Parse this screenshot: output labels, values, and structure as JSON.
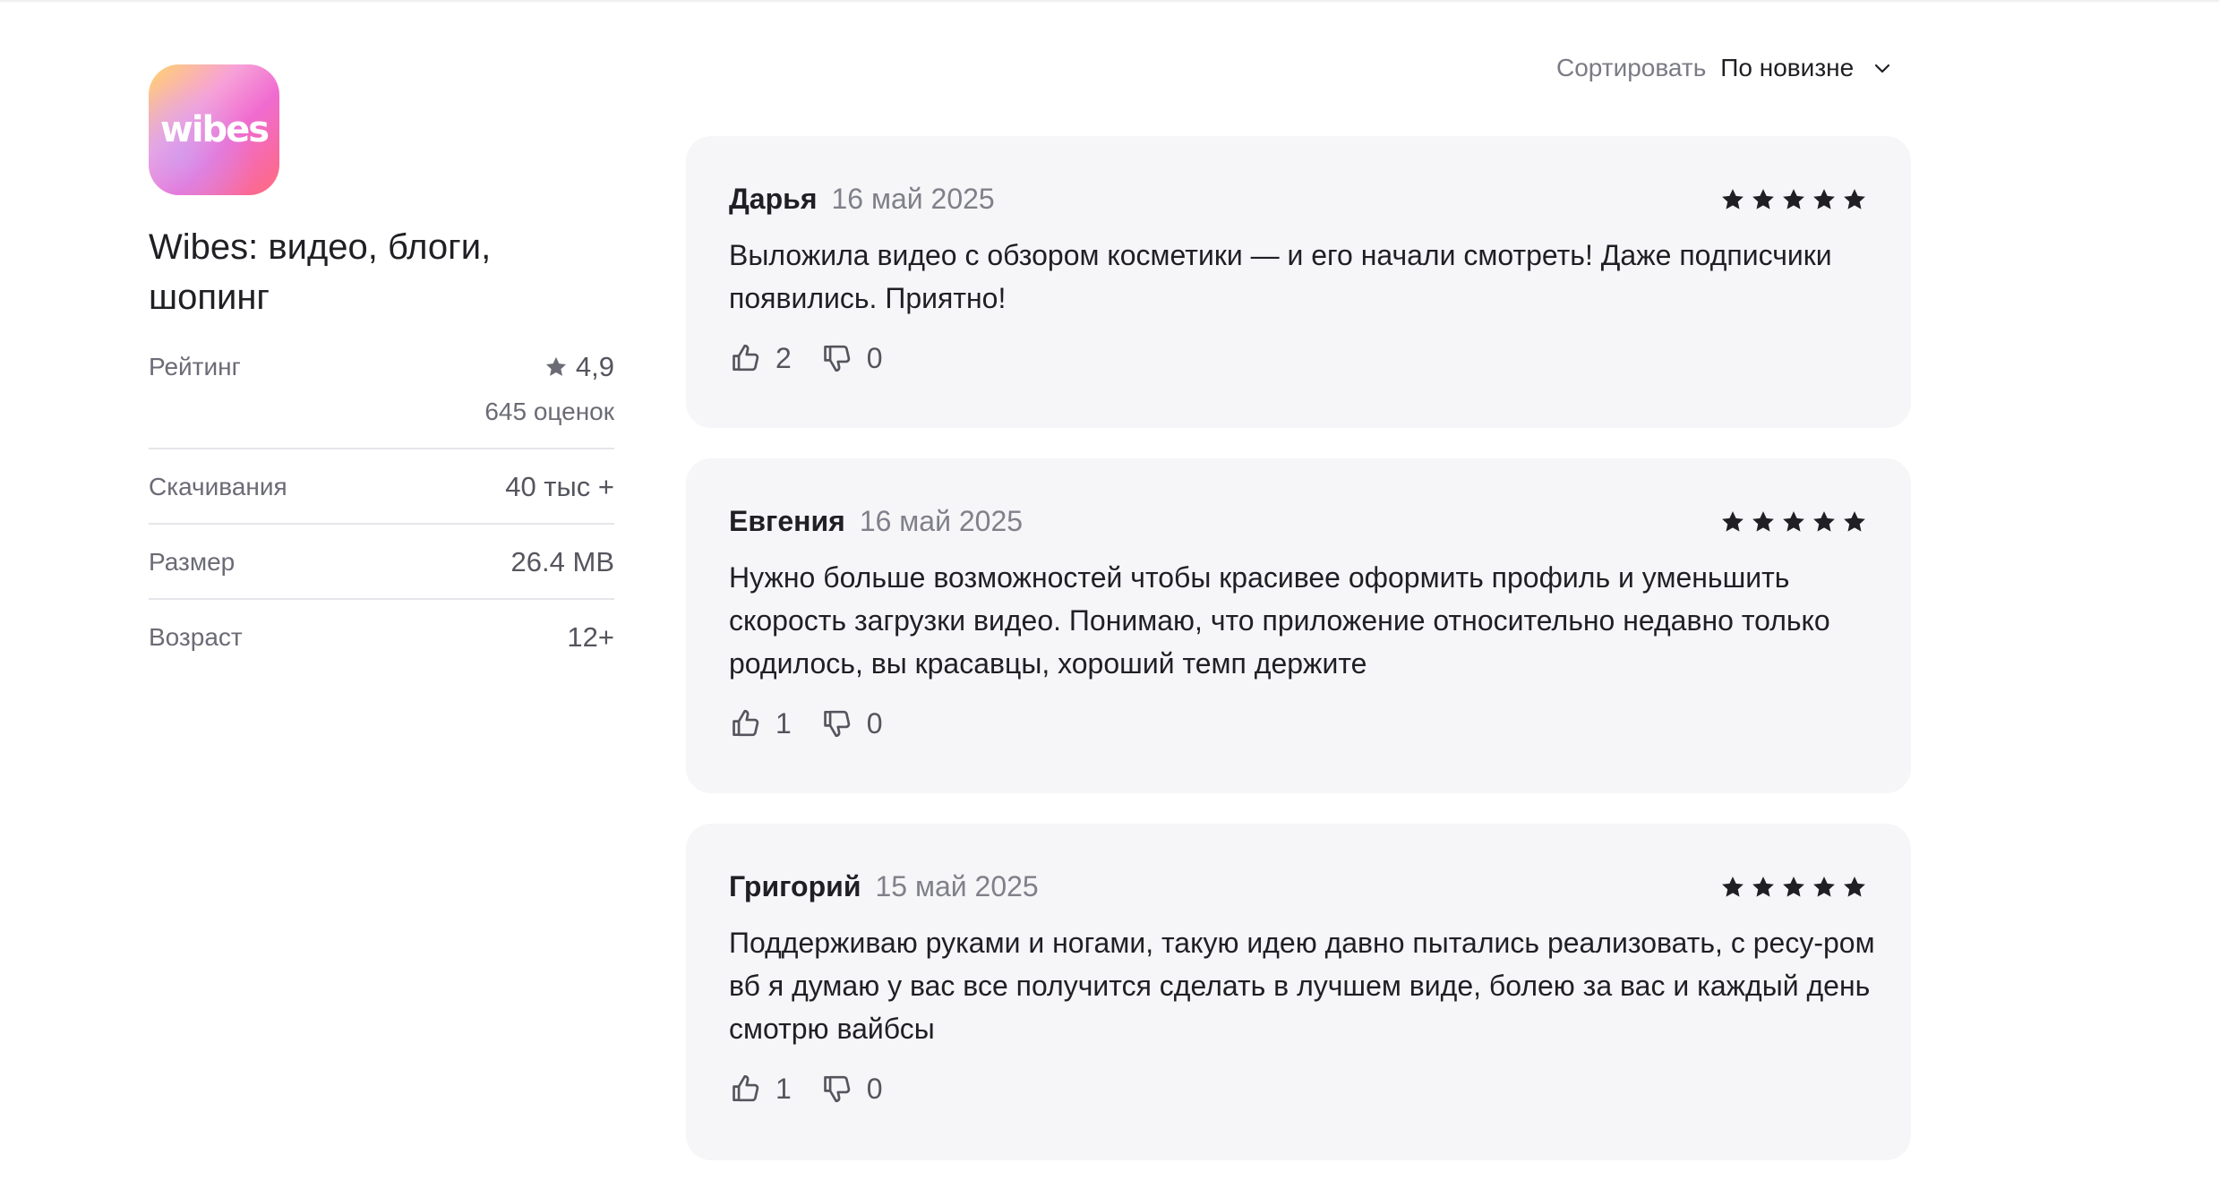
{
  "app": {
    "icon_text": "wibes",
    "title": "Wibes: видео, блоги, шопинг"
  },
  "info": {
    "rating_label": "Рейтинг",
    "rating_value": "4,9",
    "rating_count": "645 оценок",
    "downloads_label": "Скачивания",
    "downloads_value": "40 тыс +",
    "size_label": "Размер",
    "size_value": "26.4 MB",
    "age_label": "Возраст",
    "age_value": "12+"
  },
  "sort": {
    "label": "Сортировать",
    "value": "По новизне"
  },
  "reviews": [
    {
      "name": "Дарья",
      "date": "16 май 2025",
      "stars": 5,
      "text": "Выложила видео с обзором косметики — и его начали смотреть! Даже подписчики появились. Приятно!",
      "likes": "2",
      "dislikes": "0"
    },
    {
      "name": "Евгения",
      "date": "16 май 2025",
      "stars": 5,
      "text": "Нужно больше возможностей чтобы красивее оформить профиль и уменьшить скорость загрузки видео. Понимаю, что приложение относительно недавно только родилось, вы красавцы, хороший темп держите",
      "likes": "1",
      "dislikes": "0"
    },
    {
      "name": "Григорий",
      "date": "15 май 2025",
      "stars": 5,
      "text": "Поддерживаю руками и ногами, такую идею давно пытались реализовать, с ресу-ром вб я думаю у вас все получится сделать в лучшем виде, болею за вас и каждый день смотрю вайбсы",
      "likes": "1",
      "dislikes": "0"
    }
  ],
  "colors": {
    "card_bg": "#f6f6f8",
    "star": "#1f1f24",
    "muted": "#80808a"
  }
}
